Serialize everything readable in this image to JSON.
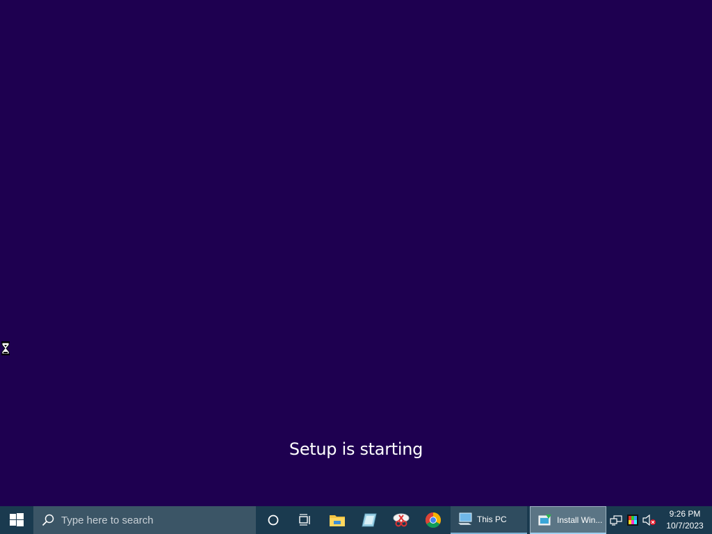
{
  "screen": {
    "status_text": "Setup is starting",
    "background_color": "#1e0050"
  },
  "cursor": {
    "icon": "hourglass-busy-icon"
  },
  "taskbar": {
    "start_icon": "windows-logo-icon",
    "search": {
      "placeholder": "Type here to search",
      "icon": "search-icon"
    },
    "pinned": [
      {
        "name": "cortana",
        "icon": "cortana-circle-icon"
      },
      {
        "name": "task-view",
        "icon": "task-view-icon"
      },
      {
        "name": "file-explorer",
        "icon": "folder-icon"
      },
      {
        "name": "notepad-app",
        "icon": "app-icon"
      },
      {
        "name": "snipping-tool",
        "icon": "scissors-icon"
      },
      {
        "name": "chrome",
        "icon": "chrome-icon"
      }
    ],
    "running": [
      {
        "label": "This PC",
        "icon": "computer-icon",
        "active": false
      },
      {
        "label": "Install Win...",
        "icon": "install-windows-icon",
        "active": true
      }
    ],
    "tray": {
      "icons": [
        "network-icon",
        "color-app-icon",
        "speaker-muted-icon"
      ],
      "time": "9:26 PM",
      "date": "10/7/2023"
    }
  }
}
